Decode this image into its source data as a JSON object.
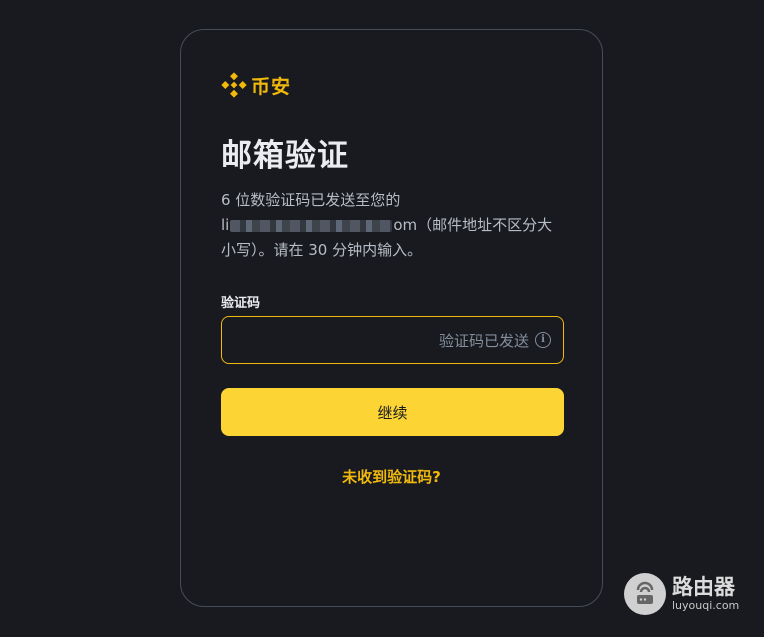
{
  "brand": {
    "name": "币安",
    "color": "#f0b90b"
  },
  "page": {
    "title": "邮箱验证",
    "desc_line1": "6 位数验证码已发送至您的",
    "email_prefix": "li",
    "email_suffix": "om",
    "desc_rest": "（邮件地址不区分大小写）。请在 30 分钟内输入。"
  },
  "form": {
    "code_label": "验证码",
    "code_value": "",
    "code_status": "验证码已发送",
    "info_icon": "info-icon",
    "continue_label": "继续",
    "resend_label": "未收到验证码?"
  },
  "watermark": {
    "title": "路由器",
    "subtitle": "luyouqi.com"
  },
  "colors": {
    "background": "#181a20",
    "accent": "#fcd535",
    "border": "#474d57",
    "text_muted": "#b7bdc6"
  }
}
